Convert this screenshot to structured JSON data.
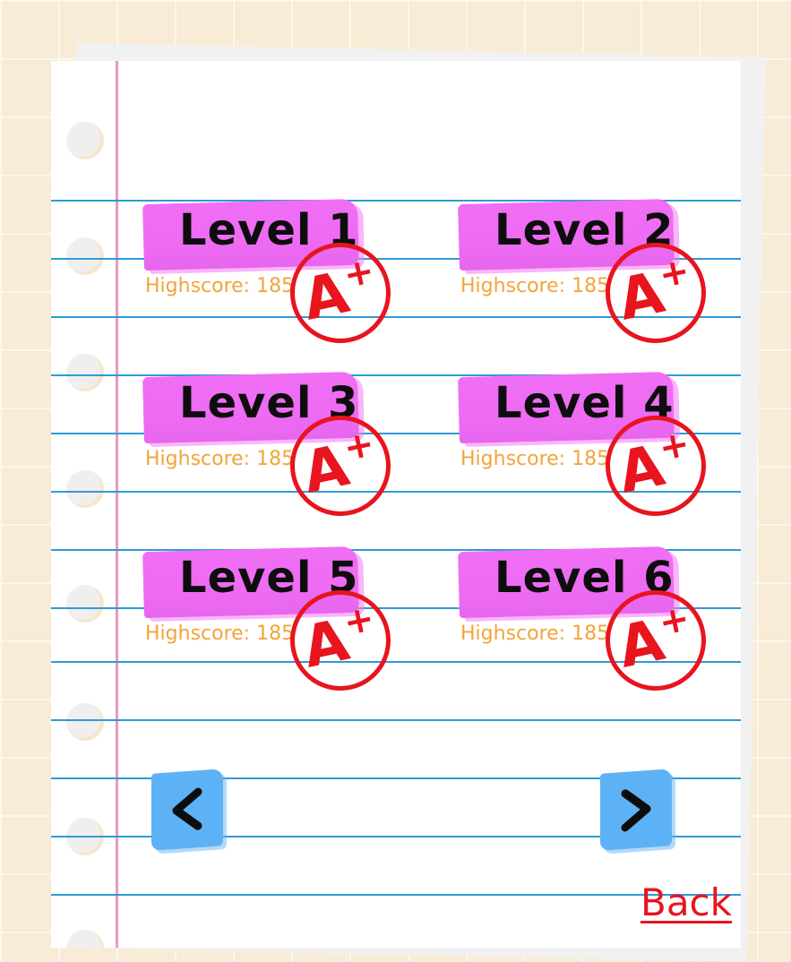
{
  "levels": [
    {
      "title": "Level 1",
      "highscore": "Highscore: 185",
      "grade": "A",
      "grade_mark": "+"
    },
    {
      "title": "Level 2",
      "highscore": "Highscore: 185",
      "grade": "A",
      "grade_mark": "+"
    },
    {
      "title": "Level 3",
      "highscore": "Highscore: 185",
      "grade": "A",
      "grade_mark": "+"
    },
    {
      "title": "Level 4",
      "highscore": "Highscore: 185",
      "grade": "A",
      "grade_mark": "+"
    },
    {
      "title": "Level 5",
      "highscore": "Highscore: 185",
      "grade": "A",
      "grade_mark": "+"
    },
    {
      "title": "Level 6",
      "highscore": "Highscore: 185",
      "grade": "A",
      "grade_mark": "+"
    }
  ],
  "nav": {
    "prev_icon": "chevron-left-icon",
    "next_icon": "chevron-right-icon"
  },
  "back_label": "Back",
  "colors": {
    "background": "#f8ecd6",
    "rule_line": "#2f9bd6",
    "margin_line": "#e79ac4",
    "tape": "#ee6cf3",
    "grade_red": "#e8141e",
    "score_orange": "#f3a43b",
    "nav_blue": "#5db2f5"
  }
}
